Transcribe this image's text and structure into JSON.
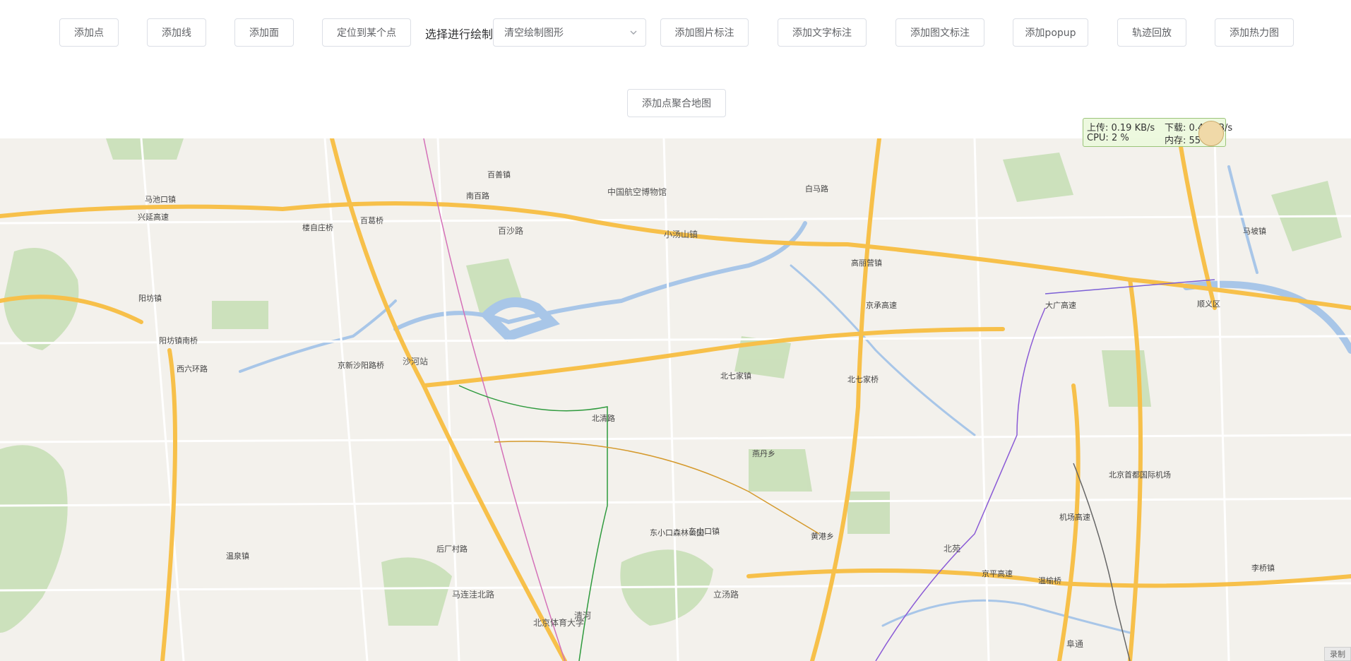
{
  "toolbar": {
    "add_point": "添加点",
    "add_line": "添加线",
    "add_polygon": "添加面",
    "locate_point": "定位到某个点",
    "draw_label": "选择进行绘制",
    "draw_select_value": "清空绘制图形",
    "add_image_marker": "添加图片标注",
    "add_text_marker": "添加文字标注",
    "add_image_text_marker": "添加图文标注",
    "add_popup": "添加popup",
    "track_playback": "轨迹回放",
    "add_heatmap": "添加热力图",
    "add_cluster_map": "添加点聚合地图"
  },
  "net_monitor": {
    "upload": "上传: 0.19 KB/s",
    "download": "下载: 0.48 KB/s",
    "cpu": "CPU: 2 %",
    "memory": "内存: 55 %"
  },
  "map_corner_tag": "录制",
  "colors": {
    "map_bg": "#f3f1ec",
    "highway": "#f7c04a",
    "road": "#ffffff",
    "water": "#a8c6e8",
    "park": "#c8dfb7"
  },
  "map": {
    "places": [
      {
        "text": "马池口镇"
      },
      {
        "text": "百善镇"
      },
      {
        "text": "南百路"
      },
      {
        "text": "白马路"
      },
      {
        "text": "百葛桥"
      },
      {
        "text": "楼自庄桥"
      },
      {
        "text": "兴延高速"
      },
      {
        "text": "阳坊镇"
      },
      {
        "text": "阳坊镇南桥"
      },
      {
        "text": "西六环路"
      },
      {
        "text": "京新沙阳路桥"
      },
      {
        "text": "北七家镇"
      },
      {
        "text": "北七家桥"
      },
      {
        "text": "高丽营镇"
      },
      {
        "text": "顺义区"
      },
      {
        "text": "马坡镇"
      },
      {
        "text": "北清路"
      },
      {
        "text": "燕丹乡"
      },
      {
        "text": "东小口镇"
      },
      {
        "text": "黄港乡"
      },
      {
        "text": "温泉镇"
      },
      {
        "text": "后厂村路"
      },
      {
        "text": "李桥镇"
      },
      {
        "text": "北京首都国际机场"
      },
      {
        "text": "京承高速"
      },
      {
        "text": "大广高速"
      },
      {
        "text": "京平高速"
      },
      {
        "text": "温榆桥"
      },
      {
        "text": "机场高速"
      },
      {
        "text": "东小口森林公园"
      },
      {
        "text": "沙河站"
      },
      {
        "text": "小汤山镇"
      },
      {
        "text": "百沙路"
      },
      {
        "text": "清河"
      },
      {
        "text": "北苑"
      },
      {
        "text": "北京体育大学"
      },
      {
        "text": "阜通"
      },
      {
        "text": "中国航空博物馆"
      },
      {
        "text": "马连洼北路"
      },
      {
        "text": "立汤路"
      }
    ]
  }
}
